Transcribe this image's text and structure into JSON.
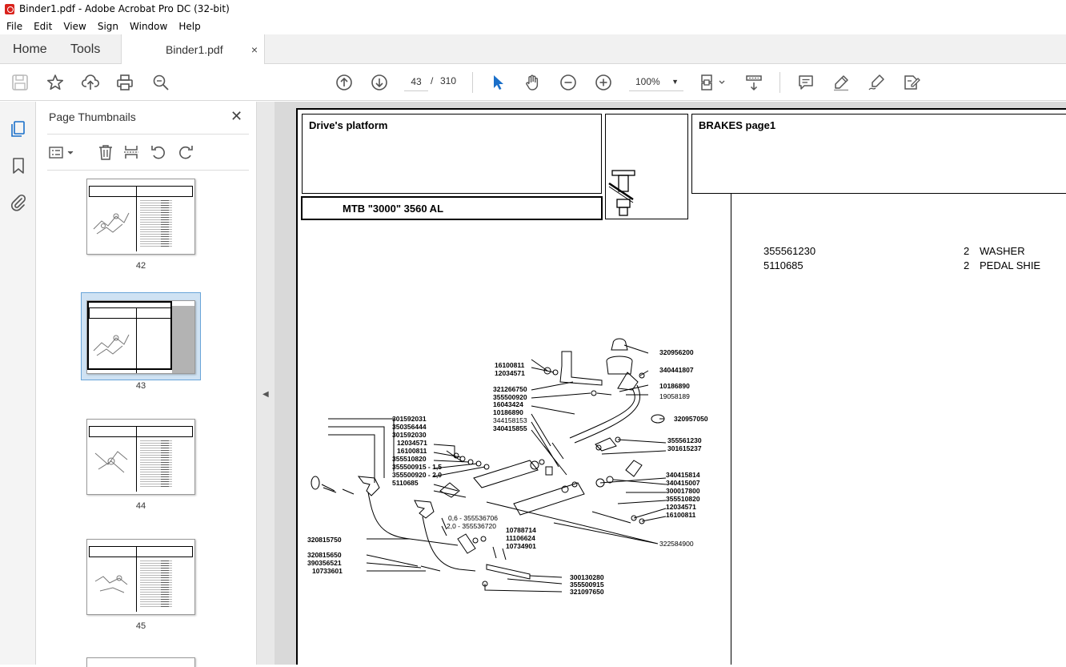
{
  "window": {
    "title": "Binder1.pdf - Adobe Acrobat Pro DC (32-bit)"
  },
  "menu": [
    "File",
    "Edit",
    "View",
    "Sign",
    "Window",
    "Help"
  ],
  "tabs": {
    "home": "Home",
    "tools": "Tools",
    "document": "Binder1.pdf",
    "close": "×"
  },
  "toolbar": {
    "page_current": "43",
    "page_separator": "/",
    "page_total": "310",
    "zoom": "100%",
    "icons": [
      "save-icon",
      "star-icon",
      "upload-icon",
      "print-icon",
      "zoom-search-icon",
      "page-up-icon",
      "page-down-icon",
      "select-cursor-icon",
      "hand-icon",
      "zoom-out-icon",
      "zoom-in-icon",
      "fit-page-icon",
      "scroll-mode-icon",
      "comment-icon",
      "highlight-icon",
      "sign-icon",
      "redact-icon"
    ]
  },
  "side_panel": {
    "title": "Page Thumbnails",
    "close": "✕",
    "thumbnails": [
      {
        "label": "42",
        "selected": false
      },
      {
        "label": "43",
        "selected": true
      },
      {
        "label": "44",
        "selected": false
      },
      {
        "label": "45",
        "selected": false
      }
    ]
  },
  "pdf": {
    "header_left": "Drive's platform",
    "header_right": "BRAKES  page1",
    "model": "MTB \"3000\" 3560 AL",
    "parts": [
      {
        "code": "355561230",
        "qty": "2",
        "desc": "WASHER"
      },
      {
        "code": "5110685",
        "qty": "2",
        "desc": "PEDAL SHIE"
      }
    ],
    "diagram_labels": [
      "320956200",
      "340441807",
      "10186890",
      "19058189",
      "320957050",
      "16100811",
      "12034571",
      "321266750",
      "355500920",
      "16043424",
      "10186890",
      "344158153",
      "340415855",
      "301592031",
      "350356444",
      "301592030",
      "12034571",
      "16100811",
      "355510820",
      "355500915 - 1,5",
      "355500920 - 2,0",
      "5110685",
      "355561230",
      "301615237",
      "340415814",
      "340415007",
      "300017800",
      "355510820",
      "12034571",
      "16100811",
      "0,6 - 355536706",
      "2,0 - 355536720",
      "10788714",
      "11106624",
      "10734901",
      "320815750",
      "320815650",
      "390356521",
      "10733601",
      "322584900",
      "300130280",
      "355500915",
      "321097650"
    ]
  }
}
